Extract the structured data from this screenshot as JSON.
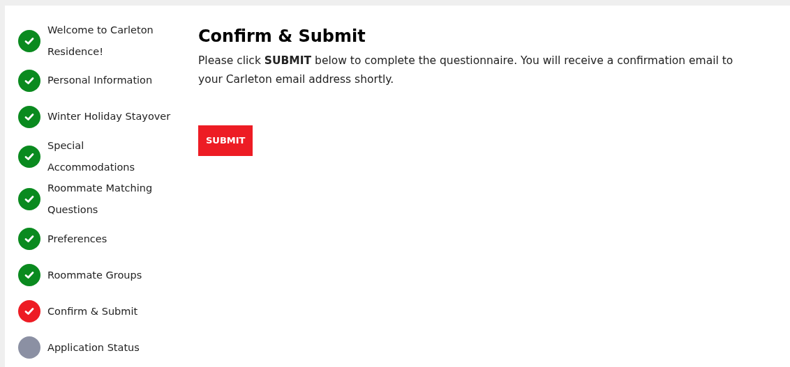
{
  "steps": [
    {
      "label": "Welcome to Carleton Residence!",
      "kind": "complete"
    },
    {
      "label": "Personal Information",
      "kind": "complete"
    },
    {
      "label": "Winter Holiday Stayover",
      "kind": "complete"
    },
    {
      "label": "Special Accommodations",
      "kind": "complete"
    },
    {
      "label": "Roommate Matching Questions",
      "kind": "complete"
    },
    {
      "label": "Preferences",
      "kind": "complete"
    },
    {
      "label": "Roommate Groups",
      "kind": "complete"
    },
    {
      "label": "Confirm & Submit",
      "kind": "current"
    },
    {
      "label": "Application Status",
      "kind": "pending"
    }
  ],
  "main": {
    "title": "Confirm & Submit",
    "message": "Please click **SUBMIT** below to complete the questionnaire. You will receive a confirmation email to your Carleton email address shortly.",
    "button": "SUBMIT"
  }
}
